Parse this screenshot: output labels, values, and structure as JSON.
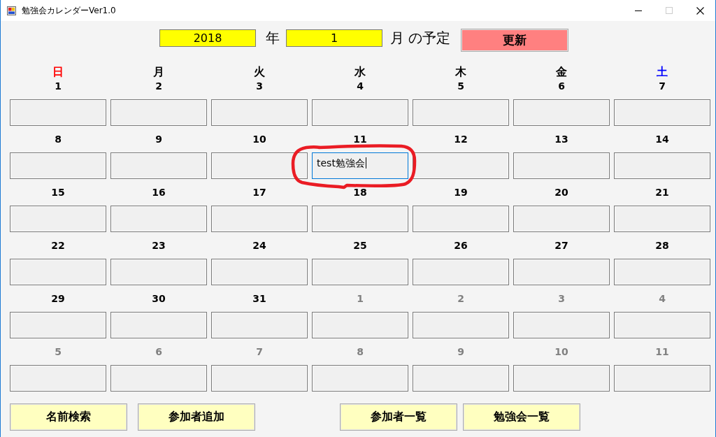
{
  "window": {
    "title": "勉強会カレンダーVer1.0",
    "controls": [
      {
        "kind": "minimize",
        "disabled": false
      },
      {
        "kind": "maximize",
        "disabled": true
      },
      {
        "kind": "close",
        "disabled": false
      }
    ]
  },
  "header": {
    "year": "2018",
    "year_unit": "年",
    "month": "1",
    "month_unit": "月 の予定",
    "update_button": "更新"
  },
  "weekdays": [
    {
      "label": "日",
      "color": "#ff0000"
    },
    {
      "label": "月",
      "color": "#000000"
    },
    {
      "label": "火",
      "color": "#000000"
    },
    {
      "label": "水",
      "color": "#000000"
    },
    {
      "label": "木",
      "color": "#000000"
    },
    {
      "label": "金",
      "color": "#000000"
    },
    {
      "label": "土",
      "color": "#0000ff"
    }
  ],
  "weeks": [
    {
      "days": [
        {
          "date": "1",
          "other_month": false,
          "focused": false,
          "circled": false
        },
        {
          "date": "2",
          "other_month": false,
          "focused": false,
          "circled": false
        },
        {
          "date": "3",
          "other_month": false,
          "focused": false,
          "circled": false
        },
        {
          "date": "4",
          "other_month": false,
          "focused": false,
          "circled": false
        },
        {
          "date": "5",
          "other_month": false,
          "focused": false,
          "circled": false
        },
        {
          "date": "6",
          "other_month": false,
          "focused": false,
          "circled": false
        },
        {
          "date": "7",
          "other_month": false,
          "focused": false,
          "circled": false
        }
      ]
    },
    {
      "days": [
        {
          "date": "8",
          "other_month": false,
          "focused": false,
          "circled": false
        },
        {
          "date": "9",
          "other_month": false,
          "focused": false,
          "circled": false
        },
        {
          "date": "10",
          "other_month": false,
          "focused": false,
          "circled": false
        },
        {
          "date": "11",
          "other_month": false,
          "focused": true,
          "circled": true,
          "text": "test勉強会"
        },
        {
          "date": "12",
          "other_month": false,
          "focused": false,
          "circled": false
        },
        {
          "date": "13",
          "other_month": false,
          "focused": false,
          "circled": false
        },
        {
          "date": "14",
          "other_month": false,
          "focused": false,
          "circled": false
        }
      ]
    },
    {
      "days": [
        {
          "date": "15",
          "other_month": false,
          "focused": false,
          "circled": false
        },
        {
          "date": "16",
          "other_month": false,
          "focused": false,
          "circled": false
        },
        {
          "date": "17",
          "other_month": false,
          "focused": false,
          "circled": false
        },
        {
          "date": "18",
          "other_month": false,
          "focused": false,
          "circled": false
        },
        {
          "date": "19",
          "other_month": false,
          "focused": false,
          "circled": false
        },
        {
          "date": "20",
          "other_month": false,
          "focused": false,
          "circled": false
        },
        {
          "date": "21",
          "other_month": false,
          "focused": false,
          "circled": false
        }
      ]
    },
    {
      "days": [
        {
          "date": "22",
          "other_month": false,
          "focused": false,
          "circled": false
        },
        {
          "date": "23",
          "other_month": false,
          "focused": false,
          "circled": false
        },
        {
          "date": "24",
          "other_month": false,
          "focused": false,
          "circled": false
        },
        {
          "date": "25",
          "other_month": false,
          "focused": false,
          "circled": false
        },
        {
          "date": "26",
          "other_month": false,
          "focused": false,
          "circled": false
        },
        {
          "date": "27",
          "other_month": false,
          "focused": false,
          "circled": false
        },
        {
          "date": "28",
          "other_month": false,
          "focused": false,
          "circled": false
        }
      ]
    },
    {
      "days": [
        {
          "date": "29",
          "other_month": false,
          "focused": false,
          "circled": false
        },
        {
          "date": "30",
          "other_month": false,
          "focused": false,
          "circled": false
        },
        {
          "date": "31",
          "other_month": false,
          "focused": false,
          "circled": false
        },
        {
          "date": "1",
          "other_month": true,
          "focused": false,
          "circled": false
        },
        {
          "date": "2",
          "other_month": true,
          "focused": false,
          "circled": false
        },
        {
          "date": "3",
          "other_month": true,
          "focused": false,
          "circled": false
        },
        {
          "date": "4",
          "other_month": true,
          "focused": false,
          "circled": false
        }
      ]
    },
    {
      "days": [
        {
          "date": "5",
          "other_month": true,
          "focused": false,
          "circled": false
        },
        {
          "date": "6",
          "other_month": true,
          "focused": false,
          "circled": false
        },
        {
          "date": "7",
          "other_month": true,
          "focused": false,
          "circled": false
        },
        {
          "date": "8",
          "other_month": true,
          "focused": false,
          "circled": false
        },
        {
          "date": "9",
          "other_month": true,
          "focused": false,
          "circled": false
        },
        {
          "date": "10",
          "other_month": true,
          "focused": false,
          "circled": false
        },
        {
          "date": "11",
          "other_month": true,
          "focused": false,
          "circled": false
        }
      ]
    }
  ],
  "footer": {
    "left_buttons": [
      "名前検索",
      "参加者追加"
    ],
    "right_buttons": [
      "参加者一覧",
      "勉強会一覧"
    ]
  }
}
